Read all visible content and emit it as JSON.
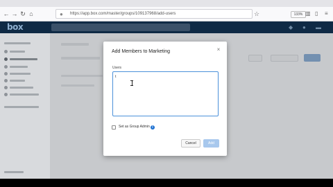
{
  "browser": {
    "url": "https://app.box.com/master/groups/109137968/add-users",
    "zoom": "133%"
  },
  "app": {
    "logo": "box"
  },
  "modal": {
    "title": "Add Members to Marketing",
    "users_label": "Users",
    "users_value": "t",
    "set_admin_label": "Set as Group Admin",
    "info_symbol": "i",
    "cancel_label": "Cancel",
    "add_label": "Add",
    "close_symbol": "×"
  },
  "icons": {
    "back": "back-arrow-icon",
    "forward": "forward-arrow-icon",
    "reload": "reload-icon",
    "home": "home-icon",
    "lock": "lock-icon",
    "star": "bookmark-star-icon",
    "library": "library-icon",
    "sidebar": "sidebar-icon",
    "menu": "hamburger-menu-icon",
    "bell": "notification-bell-icon",
    "settings": "settings-icon",
    "account": "account-icon",
    "info": "info-icon",
    "close": "close-icon"
  },
  "colors": {
    "header": "#0f2a45",
    "accent": "#1a6fd1",
    "add_button_disabled": "#a8c8ed",
    "input_focus": "#4a90d9"
  }
}
